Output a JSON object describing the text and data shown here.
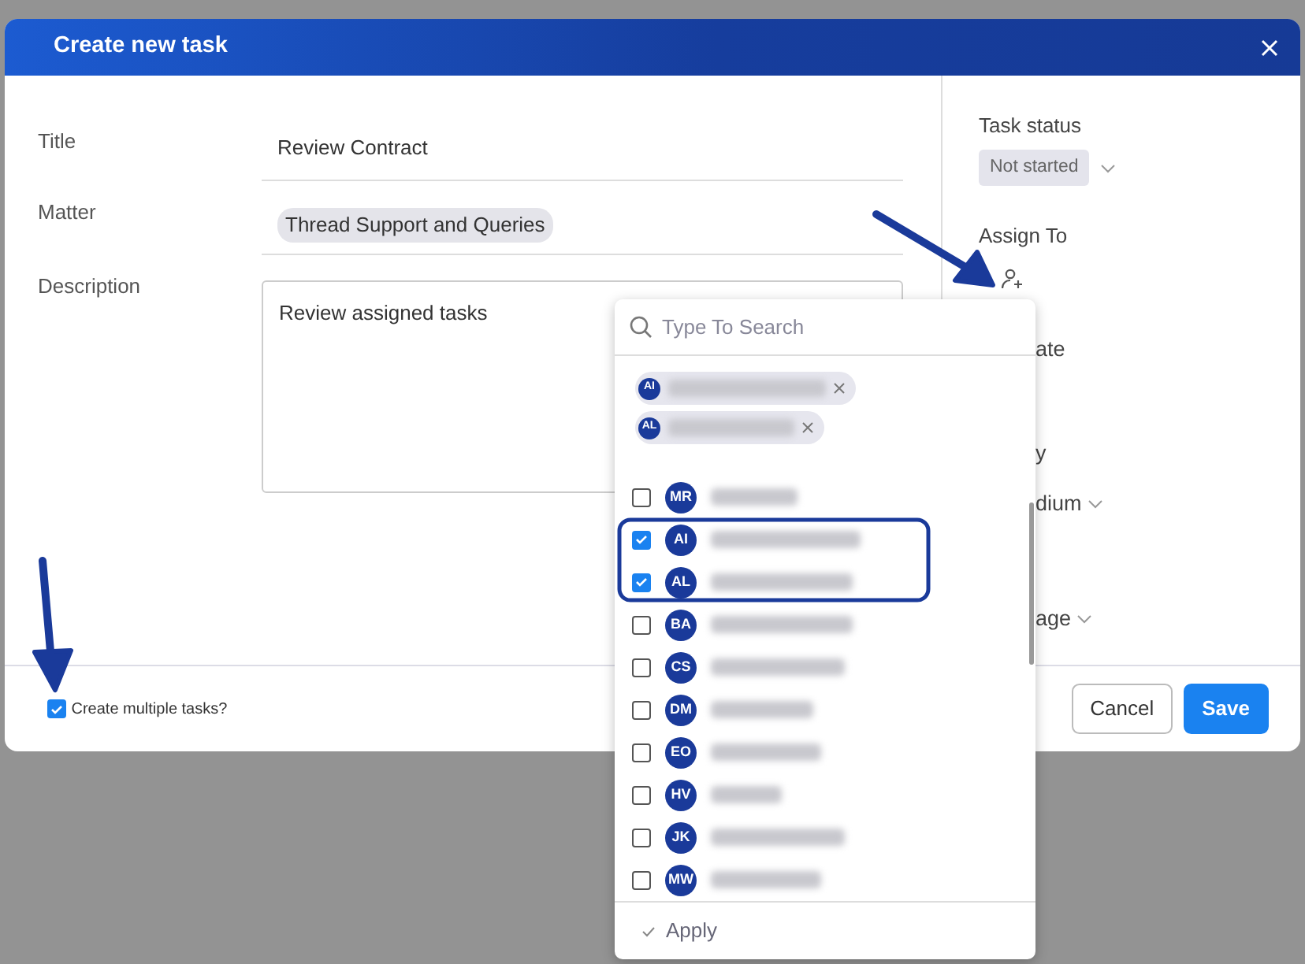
{
  "dialog": {
    "title": "Create new task"
  },
  "fields": [
    {
      "label": "Title",
      "kind": "text",
      "value": "Review Contract"
    },
    {
      "label": "Matter",
      "kind": "chip",
      "value": "Thread Support and Queries"
    },
    {
      "label": "Description",
      "kind": "textarea",
      "value": "Review assigned tasks"
    }
  ],
  "side": {
    "status_label": "Task status",
    "status": "Not started",
    "assign_label": "Assign To",
    "partial_texts": [
      {
        "text": "ate",
        "kind": "label"
      },
      {
        "text": "y",
        "kind": "label"
      },
      {
        "text": "dium",
        "kind": "select"
      },
      {
        "text": "age",
        "kind": "select"
      }
    ]
  },
  "assign_dropdown": {
    "placeholder": "Type To Search",
    "chips": [
      {
        "initials": "AI"
      },
      {
        "initials": "AL"
      }
    ],
    "members": [
      {
        "initials": "MR",
        "checked": false
      },
      {
        "initials": "AI",
        "checked": true
      },
      {
        "initials": "AL",
        "checked": true
      },
      {
        "initials": "BA",
        "checked": false
      },
      {
        "initials": "CS",
        "checked": false
      },
      {
        "initials": "DM",
        "checked": false
      },
      {
        "initials": "EO",
        "checked": false
      },
      {
        "initials": "HV",
        "checked": false
      },
      {
        "initials": "JK",
        "checked": false
      },
      {
        "initials": "MW",
        "checked": false
      }
    ],
    "apply": "Apply"
  },
  "footer": {
    "multiple": {
      "label": "Create multiple tasks?",
      "checked": true
    },
    "buttons": [
      {
        "label": "Cancel",
        "kind": "secondary"
      },
      {
        "label": "Save",
        "kind": "primary"
      }
    ]
  }
}
